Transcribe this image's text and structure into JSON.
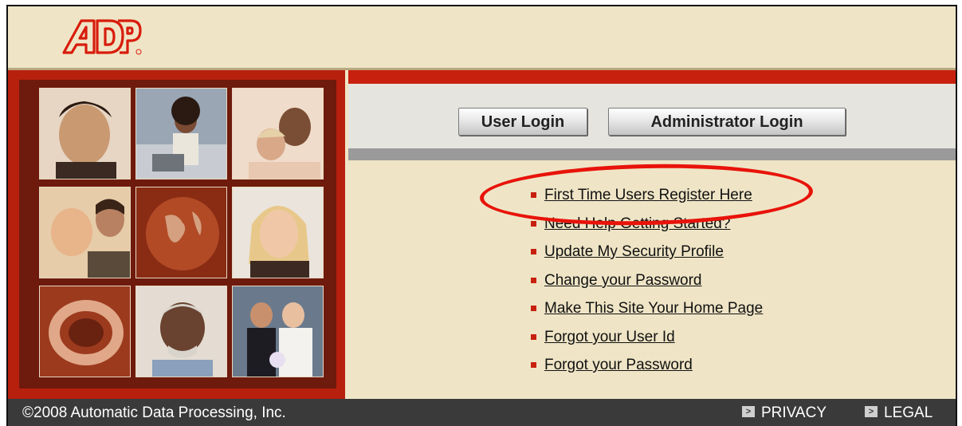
{
  "brand": {
    "logo_text": "ADP",
    "colors": {
      "brand_red": "#c8200e",
      "cream": "#efe5c6",
      "footer": "#3a3a3a"
    }
  },
  "login": {
    "user_login_label": "User Login",
    "admin_login_label": "Administrator Login"
  },
  "links": [
    {
      "label": "First Time Users Register Here"
    },
    {
      "label": "Need Help Getting Started?"
    },
    {
      "label": "Update My Security Profile"
    },
    {
      "label": "Change your Password"
    },
    {
      "label": "Make This Site Your Home Page"
    },
    {
      "label": "Forgot your User Id"
    },
    {
      "label": "Forgot your Password"
    }
  ],
  "footer": {
    "copyright": "©2008 Automatic Data Processing, Inc.",
    "privacy_label": "PRIVACY",
    "legal_label": "LEGAL"
  },
  "photos": [
    "man-portrait-photo",
    "woman-at-laptop-photo",
    "couple-photo",
    "father-baby-photo",
    "globe-photo",
    "smiling-woman-photo",
    "ring-object-photo",
    "older-man-photo",
    "wedding-couple-photo"
  ]
}
